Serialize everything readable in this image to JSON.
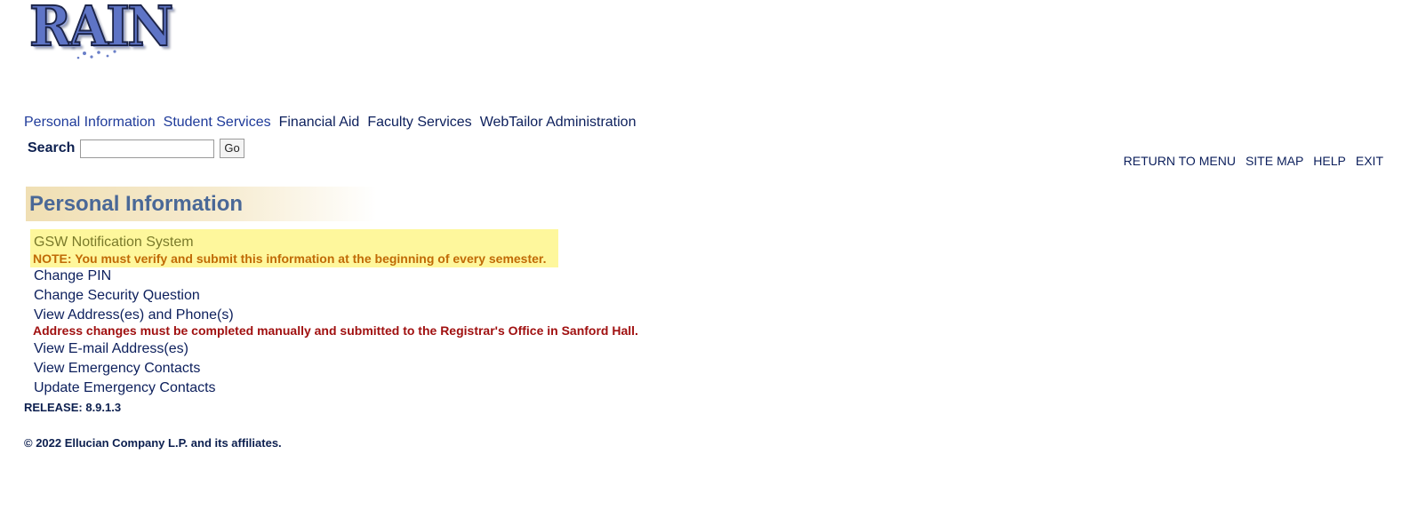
{
  "logo": {
    "text": "RAIN"
  },
  "top_nav": [
    {
      "label": "Personal Information"
    },
    {
      "label": "Student Services"
    },
    {
      "label": "Financial Aid"
    },
    {
      "label": "Faculty Services"
    },
    {
      "label": "WebTailor Administration"
    }
  ],
  "search": {
    "label": "Search",
    "value": "",
    "button": "Go"
  },
  "right_links": [
    {
      "label": "RETURN TO MENU"
    },
    {
      "label": "SITE MAP"
    },
    {
      "label": "HELP"
    },
    {
      "label": "EXIT"
    }
  ],
  "page_title": "Personal Information",
  "highlight": {
    "link": "GSW Notification System",
    "note": "NOTE: You must verify and submit this information at the beginning of every semester."
  },
  "menu": {
    "change_pin": "Change PIN",
    "change_security_question": "Change Security Question",
    "view_address_phone": "View Address(es) and Phone(s)",
    "address_note": "Address changes must be completed manually and submitted to the Registrar's Office in Sanford Hall.",
    "view_email": "View E-mail Address(es)",
    "view_emergency": "View Emergency Contacts",
    "update_emergency": "Update Emergency Contacts"
  },
  "release": "RELEASE: 8.9.1.3",
  "copyright": "© 2022 Ellucian Company L.P. and its affiliates.",
  "colors": {
    "nav_link": "#1f3b9a",
    "nav_link_dark": "#0c1f5c",
    "title": "#4a6897",
    "highlight_bg": "#fef79c",
    "note": "#c06a06",
    "warning": "#a01010"
  }
}
